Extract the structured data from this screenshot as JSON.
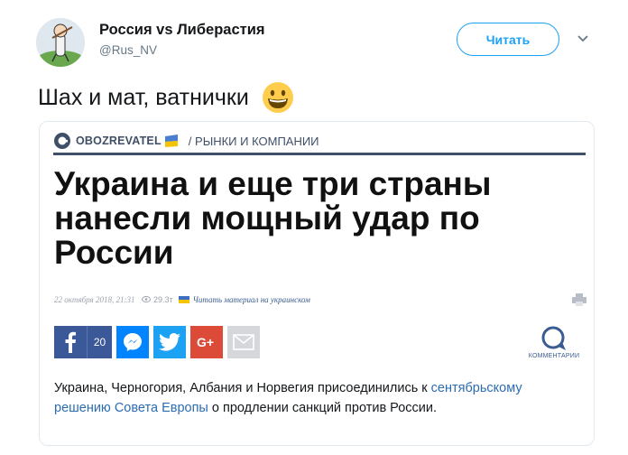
{
  "header": {
    "display_name": "Россия vs Либерастия",
    "handle": "@Rus_NV",
    "follow_label": "Читать"
  },
  "tweet": {
    "text": "Шах и мат, ватнички"
  },
  "card": {
    "brand_name": "OBOZREVATEL",
    "section": "/ РЫНКИ И КОМПАНИИ",
    "headline": "Украина и еще три страны нанесли мощный удар по России",
    "meta_date": "22 октября 2018, 21:31",
    "meta_views": "29.3т",
    "meta_read_link": "Читать материал на украинском",
    "facebook_count": "20",
    "comments_label": "КОММЕНТАРИИ",
    "desc_before": "Украина, Черногория, Албания и Норвегия присоединились к ",
    "desc_link": "сентябрьскому решению Совета Европы",
    "desc_after": " о продлении санкций против России."
  },
  "colors": {
    "twitter_blue": "#1da1f2",
    "brand_navy": "#3f4f67",
    "facebook": "#3b5998",
    "messenger": "#0084ff",
    "google_plus": "#dc4a38",
    "link": "#2c6cb0"
  },
  "icons": {
    "avatar": "avatar-image",
    "menu": "chevron-down-icon",
    "emoji": "grinning-face-emoji",
    "brand": "obozrevatel-logo-icon",
    "print": "print-icon",
    "comments": "comments-icon"
  }
}
